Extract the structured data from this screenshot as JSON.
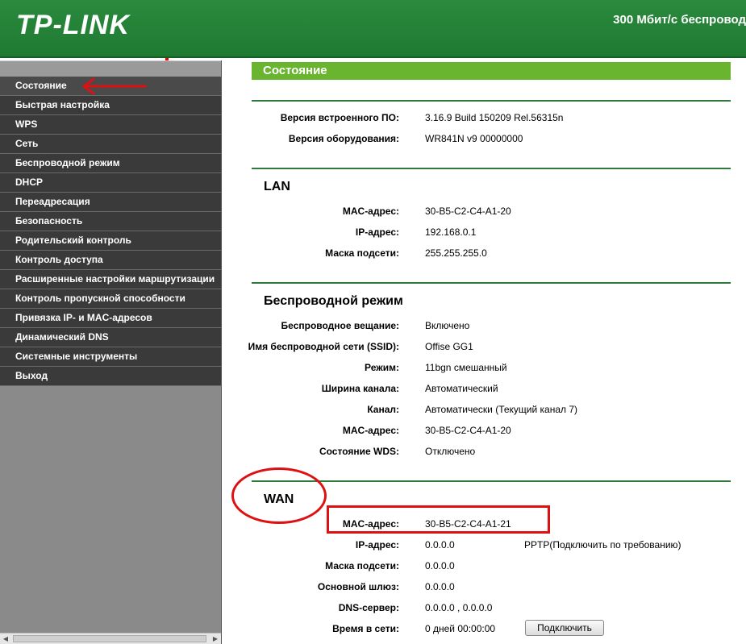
{
  "header": {
    "logo_text": "TP-LINK",
    "title": "300 Мбит/с беспровод"
  },
  "sidebar": {
    "items": [
      {
        "label": "Состояние",
        "active": true
      },
      {
        "label": "Быстрая настройка"
      },
      {
        "label": "WPS"
      },
      {
        "label": "Сеть"
      },
      {
        "label": "Беспроводной режим"
      },
      {
        "label": "DHCP"
      },
      {
        "label": "Переадресация"
      },
      {
        "label": "Безопасность"
      },
      {
        "label": "Родительский контроль"
      },
      {
        "label": "Контроль доступа"
      },
      {
        "label": "Расширенные настройки маршрутизации"
      },
      {
        "label": "Контроль пропускной способности"
      },
      {
        "label": "Привязка IP- и MAC-адресов"
      },
      {
        "label": "Динамический DNS"
      },
      {
        "label": "Системные инструменты"
      },
      {
        "label": "Выход"
      }
    ]
  },
  "main": {
    "title": "Состояние",
    "firmware": {
      "fw_label": "Версия встроенного ПО:",
      "fw_value": "3.16.9 Build 150209 Rel.56315n",
      "hw_label": "Версия оборудования:",
      "hw_value": "WR841N v9 00000000"
    },
    "lan": {
      "heading": "LAN",
      "mac_label": "MAC-адрес:",
      "mac_value": "30-B5-C2-C4-A1-20",
      "ip_label": "IP-адрес:",
      "ip_value": "192.168.0.1",
      "mask_label": "Маска подсети:",
      "mask_value": "255.255.255.0"
    },
    "wireless": {
      "heading": "Беспроводной режим",
      "broadcast_label": "Беспроводное вещание:",
      "broadcast_value": "Включено",
      "ssid_label": "Имя беспроводной сети (SSID):",
      "ssid_value": "Offise GG1",
      "mode_label": "Режим:",
      "mode_value": "11bgn смешанный",
      "width_label": "Ширина канала:",
      "width_value": "Автоматический",
      "channel_label": "Канал:",
      "channel_value": "Автоматически (Текущий канал 7)",
      "mac_label": "MAC-адрес:",
      "mac_value": "30-B5-C2-C4-A1-20",
      "wds_label": "Состояние WDS:",
      "wds_value": "Отключено"
    },
    "wan": {
      "heading": "WAN",
      "mac_label": "MAC-адрес:",
      "mac_value": "30-B5-C2-C4-A1-21",
      "ip_label": "IP-адрес:",
      "ip_value": "0.0.0.0",
      "connection_type": "PPTP(Подключить по требованию)",
      "mask_label": "Маска подсети:",
      "mask_value": "0.0.0.0",
      "gateway_label": "Основной шлюз:",
      "gateway_value": "0.0.0.0",
      "dns_label": "DNS-сервер:",
      "dns_value": "0.0.0.0 , 0.0.0.0",
      "uptime_label": "Время в сети:",
      "uptime_value": "0 дней 00:00:00",
      "connect_button": "Подключить"
    }
  },
  "colors": {
    "header_green": "#1f7a31",
    "title_green": "#6ab52f",
    "menu_dark": "#3a3a3a",
    "annotation_red": "#dd1111"
  }
}
